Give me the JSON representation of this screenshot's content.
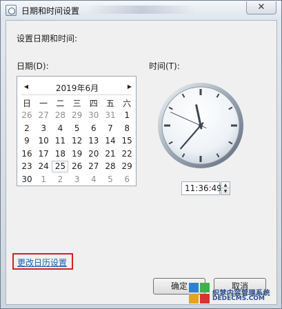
{
  "window": {
    "title": "日期和时间设置",
    "close_glyph": "✕"
  },
  "heading": "设置日期和时间:",
  "date_label": "日期(D):",
  "time_label": "时间(T):",
  "calendar": {
    "month_label": "2019年6月",
    "prev_glyph": "◀",
    "next_glyph": "▶",
    "weekdays": [
      "日",
      "一",
      "二",
      "三",
      "四",
      "五",
      "六"
    ],
    "weeks": [
      [
        {
          "d": "26",
          "other": true
        },
        {
          "d": "27",
          "other": true
        },
        {
          "d": "28",
          "other": true
        },
        {
          "d": "29",
          "other": true
        },
        {
          "d": "30",
          "other": true
        },
        {
          "d": "31",
          "other": true
        },
        {
          "d": "1"
        }
      ],
      [
        {
          "d": "2"
        },
        {
          "d": "3"
        },
        {
          "d": "4"
        },
        {
          "d": "5"
        },
        {
          "d": "6"
        },
        {
          "d": "7"
        },
        {
          "d": "8"
        }
      ],
      [
        {
          "d": "9"
        },
        {
          "d": "10"
        },
        {
          "d": "11"
        },
        {
          "d": "12"
        },
        {
          "d": "13"
        },
        {
          "d": "14"
        },
        {
          "d": "15"
        }
      ],
      [
        {
          "d": "16"
        },
        {
          "d": "17"
        },
        {
          "d": "18"
        },
        {
          "d": "19"
        },
        {
          "d": "20"
        },
        {
          "d": "21"
        },
        {
          "d": "22"
        }
      ],
      [
        {
          "d": "23"
        },
        {
          "d": "24"
        },
        {
          "d": "25",
          "today": true
        },
        {
          "d": "26"
        },
        {
          "d": "27"
        },
        {
          "d": "28"
        },
        {
          "d": "29"
        }
      ],
      [
        {
          "d": "30"
        },
        {
          "d": "1",
          "other": true
        },
        {
          "d": "2",
          "other": true
        },
        {
          "d": "3",
          "other": true
        },
        {
          "d": "4",
          "other": true
        },
        {
          "d": "5",
          "other": true
        },
        {
          "d": "6",
          "other": true
        }
      ]
    ]
  },
  "clock": {
    "hour": 11,
    "minute": 36,
    "second": 49
  },
  "time_value": "11:36:49",
  "change_calendar_link": "更改日历设置",
  "buttons": {
    "ok": "确定",
    "cancel": "取消"
  },
  "watermark": {
    "line1": "织梦内容管理系统",
    "line2": "DEDECMS.COM"
  },
  "colors": {
    "link": "#1461b0",
    "highlight_border": "#d81e1e"
  }
}
